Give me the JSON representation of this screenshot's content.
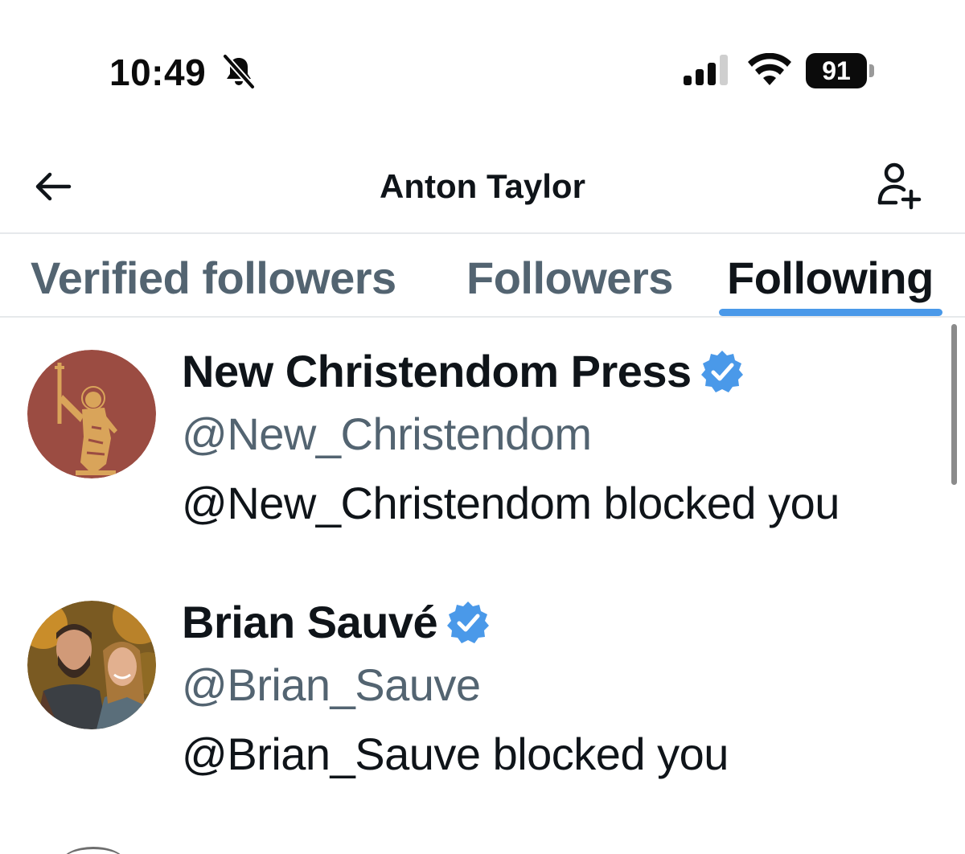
{
  "status_bar": {
    "time": "10:49",
    "silent_icon": "bell-slash-icon",
    "signal_icon": "cellular-signal-icon",
    "wifi_icon": "wifi-icon",
    "battery_level": "91"
  },
  "header": {
    "back_icon": "arrow-left-icon",
    "title": "Anton Taylor",
    "add_icon": "person-add-icon"
  },
  "tabs": [
    {
      "label": "Verified followers",
      "active": false
    },
    {
      "label": "Followers",
      "active": false
    },
    {
      "label": "Following",
      "active": true
    }
  ],
  "colors": {
    "accent": "#4a99e9",
    "verified_badge": "#4a99e9",
    "text_primary": "#0f1419",
    "text_secondary": "#536471"
  },
  "accounts": [
    {
      "name": "New Christendom Press",
      "verified": true,
      "handle": "@New_Christendom",
      "note": "@New_Christendom blocked you",
      "avatar": "statue-illustration"
    },
    {
      "name": "Brian Sauvé",
      "verified": true,
      "handle": "@Brian_Sauve",
      "note": "@Brian_Sauve blocked you",
      "avatar": "couple-photo"
    }
  ]
}
